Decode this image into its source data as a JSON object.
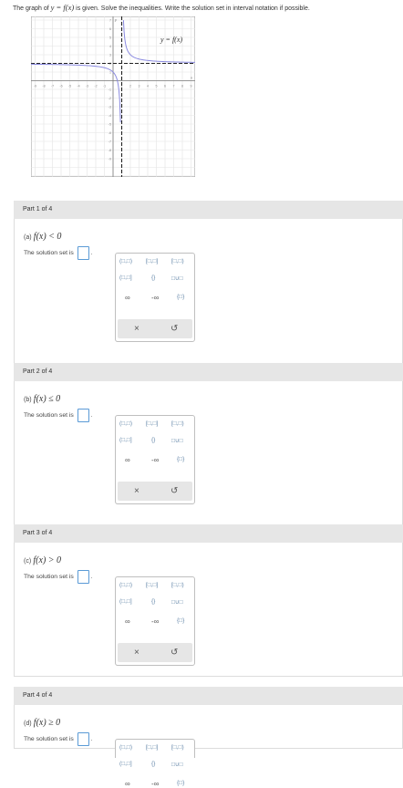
{
  "intro": {
    "prefix": "The graph of ",
    "func": "y = f(x)",
    "suffix": " is given. Solve the inequalities. Write the solution set in interval notation if possible."
  },
  "graph": {
    "label": "y = f(x)",
    "x_ticks": [
      "-9",
      "-8",
      "-7",
      "-6",
      "-5",
      "-4",
      "-3",
      "-2",
      "-1",
      "",
      "1",
      "2",
      "3",
      "4",
      "5",
      "6",
      "7",
      "8",
      "9"
    ],
    "y_ticks": [
      "9",
      "8",
      "7",
      "6",
      "5",
      "4",
      "3",
      "2",
      "1",
      "",
      "-1",
      "-2",
      "-3",
      "-4",
      "-5",
      "-6",
      "-7",
      "-8",
      "-9"
    ],
    "axis_x_label": "x",
    "axis_y_label": "y",
    "vertical_asymptote": 1,
    "horizontal_asymptote": 2,
    "curve_color": "#8a8ae0"
  },
  "parts": [
    {
      "header": "Part 1 of 4",
      "letter": "(a)",
      "ineq": "f(x) < 0",
      "solution_label": "The solution set is"
    },
    {
      "header": "Part 2 of 4",
      "letter": "(b)",
      "ineq": "f(x) ≤ 0",
      "solution_label": "The solution set is"
    },
    {
      "header": "Part 3 of 4",
      "letter": "(c)",
      "ineq": "f(x) > 0",
      "solution_label": "The solution set is"
    },
    {
      "header": "Part 4 of 4",
      "letter": "(d)",
      "ineq": "f(x) ≥ 0",
      "solution_label": "The solution set is"
    }
  ],
  "keypad": {
    "row1": [
      "(□,□)",
      "[□,□]",
      "[□,□)"
    ],
    "row2": [
      "(□,□]",
      "{}",
      "□∪□"
    ],
    "row3": [
      "∞",
      "-∞",
      "{□}"
    ],
    "clear": "×",
    "undo": "↺"
  },
  "colors": {
    "header_bg": "#e6e6e6",
    "answer_border": "#5a9ad6",
    "key_text": "#6688aa"
  }
}
